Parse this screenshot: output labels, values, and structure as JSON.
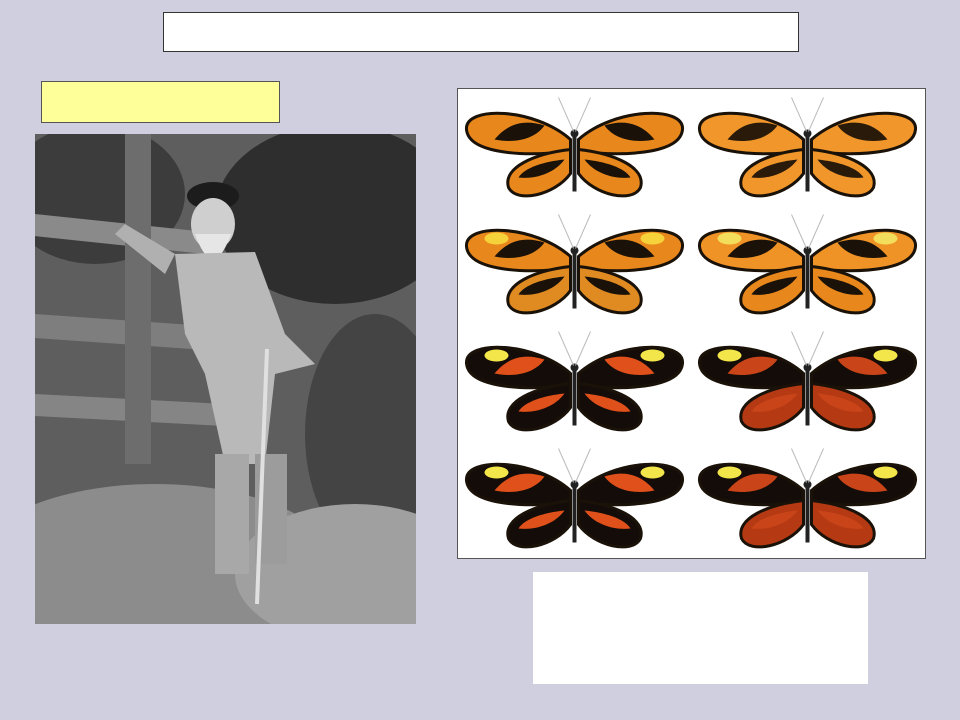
{
  "slide": {
    "title": "",
    "caption": "",
    "note": ""
  },
  "photo": {
    "icon": "portrait-photo-icon"
  },
  "butterflies": [
    {
      "icon": "butterfly-icon",
      "forewing": "#e8871c",
      "hindwing": "#e8871c",
      "band": "#1a1208",
      "spot": "#e8871c"
    },
    {
      "icon": "butterfly-icon",
      "forewing": "#f0962a",
      "hindwing": "#f0962a",
      "band": "#2a1a0a",
      "spot": "#f0962a"
    },
    {
      "icon": "butterfly-icon",
      "forewing": "#e8871c",
      "hindwing": "#e08a22",
      "band": "#1a1208",
      "spot": "#f6d23a"
    },
    {
      "icon": "butterfly-icon",
      "forewing": "#ef9326",
      "hindwing": "#e8871c",
      "band": "#1a1208",
      "spot": "#f2de5a"
    },
    {
      "icon": "butterfly-icon",
      "forewing": "#140c08",
      "hindwing": "#140c08",
      "band": "#e0501a",
      "spot": "#f2e64a"
    },
    {
      "icon": "butterfly-icon",
      "forewing": "#140c08",
      "hindwing": "#b53a14",
      "band": "#c94418",
      "spot": "#f2e64a"
    },
    {
      "icon": "butterfly-icon",
      "forewing": "#140c08",
      "hindwing": "#140c08",
      "band": "#e0501a",
      "spot": "#f2e64a"
    },
    {
      "icon": "butterfly-icon",
      "forewing": "#140c08",
      "hindwing": "#b53a14",
      "band": "#c94418",
      "spot": "#f2e64a"
    }
  ]
}
